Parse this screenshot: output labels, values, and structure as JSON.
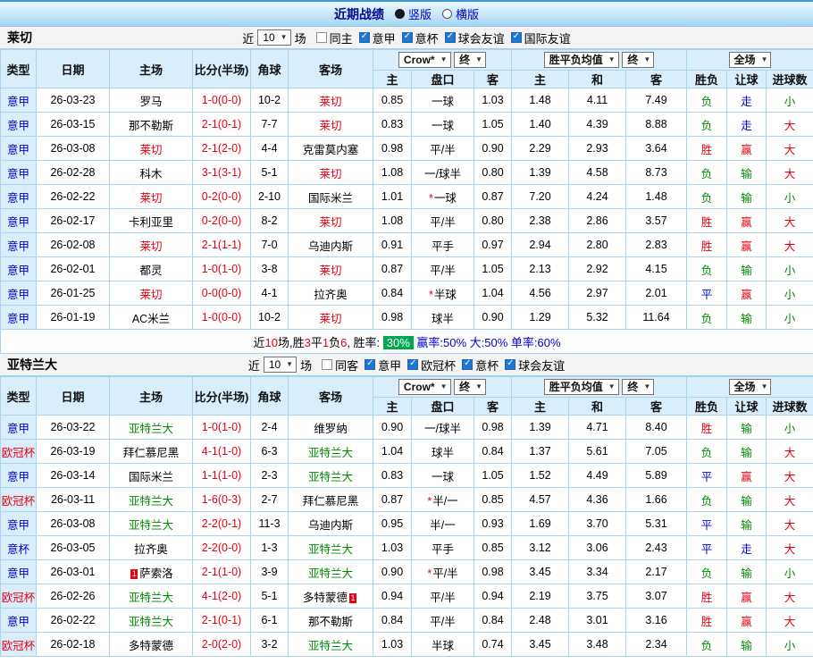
{
  "topbar": {
    "title": "近期战绩",
    "options": [
      {
        "label": "竖版",
        "selected": true
      },
      {
        "label": "横版",
        "selected": false
      }
    ]
  },
  "filter_labels": {
    "near": "近",
    "games": "场"
  },
  "table_header": {
    "type": "类型",
    "date": "日期",
    "home": "主场",
    "score": "比分(半场)",
    "corner": "角球",
    "away": "客场",
    "company": "Crow*",
    "final1": "终",
    "wdl": "胜平负均值",
    "final2": "终",
    "scope": "全场",
    "sub": [
      "主",
      "盘口",
      "客",
      "主",
      "和",
      "客",
      "胜负",
      "让球",
      "进球数"
    ]
  },
  "sections": [
    {
      "team": "莱切",
      "filter": {
        "count": "10",
        "checkboxes": [
          {
            "label": "同主",
            "checked": false
          },
          {
            "label": "意甲",
            "checked": true
          },
          {
            "label": "意杯",
            "checked": true
          },
          {
            "label": "球会友谊",
            "checked": true
          },
          {
            "label": "国际友谊",
            "checked": true
          }
        ]
      },
      "rows": [
        {
          "league": "意甲",
          "league_color": "blue",
          "date": "26-03-23",
          "home": "罗马",
          "home_color": "black",
          "score": "1-0(0-0)",
          "corner": "10-2",
          "away": "莱切",
          "away_color": "red",
          "h_odds": "0.85",
          "handicap": "一球",
          "a_odds": "1.03",
          "win": "1.48",
          "draw": "4.11",
          "lose": "7.49",
          "result": "负",
          "result_color": "green",
          "spread": "走",
          "spread_color": "blue",
          "goals": "小",
          "goals_color": "green"
        },
        {
          "league": "意甲",
          "league_color": "blue",
          "date": "26-03-15",
          "home": "那不勒斯",
          "home_color": "black",
          "score": "2-1(0-1)",
          "corner": "7-7",
          "away": "莱切",
          "away_color": "red",
          "h_odds": "0.83",
          "handicap": "一球",
          "a_odds": "1.05",
          "win": "1.40",
          "draw": "4.39",
          "lose": "8.88",
          "result": "负",
          "result_color": "green",
          "spread": "走",
          "spread_color": "blue",
          "goals": "大",
          "goals_color": "red"
        },
        {
          "league": "意甲",
          "league_color": "blue",
          "date": "26-03-08",
          "home": "莱切",
          "home_color": "red",
          "score": "2-1(2-0)",
          "corner": "4-4",
          "away": "克雷莫内塞",
          "away_color": "black",
          "h_odds": "0.98",
          "handicap": "平/半",
          "a_odds": "0.90",
          "win": "2.29",
          "draw": "2.93",
          "lose": "3.64",
          "result": "胜",
          "result_color": "red",
          "spread": "赢",
          "spread_color": "red",
          "goals": "大",
          "goals_color": "red"
        },
        {
          "league": "意甲",
          "league_color": "blue",
          "date": "26-02-28",
          "home": "科木",
          "home_color": "black",
          "score": "3-1(3-1)",
          "corner": "5-1",
          "away": "莱切",
          "away_color": "red",
          "h_odds": "1.08",
          "handicap": "一/球半",
          "a_odds": "0.80",
          "win": "1.39",
          "draw": "4.58",
          "lose": "8.73",
          "result": "负",
          "result_color": "green",
          "spread": "输",
          "spread_color": "green",
          "goals": "大",
          "goals_color": "red"
        },
        {
          "league": "意甲",
          "league_color": "blue",
          "date": "26-02-22",
          "home": "莱切",
          "home_color": "red",
          "score": "0-2(0-0)",
          "corner": "2-10",
          "away": "国际米兰",
          "away_color": "black",
          "h_odds": "1.01",
          "hstar": "*",
          "handicap": "一球",
          "a_odds": "0.87",
          "win": "7.20",
          "draw": "4.24",
          "lose": "1.48",
          "result": "负",
          "result_color": "green",
          "spread": "输",
          "spread_color": "green",
          "goals": "小",
          "goals_color": "green"
        },
        {
          "league": "意甲",
          "league_color": "blue",
          "date": "26-02-17",
          "home": "卡利亚里",
          "home_color": "black",
          "score": "0-2(0-0)",
          "corner": "8-2",
          "away": "莱切",
          "away_color": "red",
          "h_odds": "1.08",
          "handicap": "平/半",
          "a_odds": "0.80",
          "win": "2.38",
          "draw": "2.86",
          "lose": "3.57",
          "result": "胜",
          "result_color": "red",
          "spread": "赢",
          "spread_color": "red",
          "goals": "大",
          "goals_color": "red"
        },
        {
          "league": "意甲",
          "league_color": "blue",
          "date": "26-02-08",
          "home": "莱切",
          "home_color": "red",
          "score": "2-1(1-1)",
          "corner": "7-0",
          "away": "乌迪内斯",
          "away_color": "black",
          "h_odds": "0.91",
          "handicap": "平手",
          "a_odds": "0.97",
          "win": "2.94",
          "draw": "2.80",
          "lose": "2.83",
          "result": "胜",
          "result_color": "red",
          "spread": "赢",
          "spread_color": "red",
          "goals": "大",
          "goals_color": "red"
        },
        {
          "league": "意甲",
          "league_color": "blue",
          "date": "26-02-01",
          "home": "都灵",
          "home_color": "black",
          "score": "1-0(1-0)",
          "corner": "3-8",
          "away": "莱切",
          "away_color": "red",
          "h_odds": "0.87",
          "handicap": "平/半",
          "a_odds": "1.05",
          "win": "2.13",
          "draw": "2.92",
          "lose": "4.15",
          "result": "负",
          "result_color": "green",
          "spread": "输",
          "spread_color": "green",
          "goals": "小",
          "goals_color": "green"
        },
        {
          "league": "意甲",
          "league_color": "blue",
          "date": "26-01-25",
          "home": "莱切",
          "home_color": "red",
          "score": "0-0(0-0)",
          "corner": "4-1",
          "away": "拉齐奥",
          "away_color": "black",
          "h_odds": "0.84",
          "hstar": "*",
          "handicap": "半球",
          "a_odds": "1.04",
          "win": "4.56",
          "draw": "2.97",
          "lose": "2.01",
          "result": "平",
          "result_color": "blue",
          "spread": "赢",
          "spread_color": "red",
          "goals": "小",
          "goals_color": "green"
        },
        {
          "league": "意甲",
          "league_color": "blue",
          "date": "26-01-19",
          "home": "AC米兰",
          "home_color": "black",
          "score": "1-0(0-0)",
          "corner": "10-2",
          "away": "莱切",
          "away_color": "red",
          "h_odds": "0.98",
          "handicap": "球半",
          "a_odds": "0.90",
          "win": "1.29",
          "draw": "5.32",
          "lose": "11.64",
          "result": "负",
          "result_color": "green",
          "spread": "输",
          "spread_color": "green",
          "goals": "小",
          "goals_color": "green"
        }
      ],
      "footer": [
        {
          "text": "近",
          "style": "black"
        },
        {
          "text": "10",
          "style": "red"
        },
        {
          "text": "场,胜",
          "style": "black"
        },
        {
          "text": "3",
          "style": "red"
        },
        {
          "text": "平",
          "style": "black"
        },
        {
          "text": "1",
          "style": "red"
        },
        {
          "text": "负",
          "style": "black"
        },
        {
          "text": "6",
          "style": "red"
        },
        {
          "text": ", 胜率: ",
          "style": "black"
        },
        {
          "text": "30%",
          "style": "badge"
        },
        {
          "text": " 赢率:50%",
          "style": "blue"
        },
        {
          "text": " 大:50%",
          "style": "blue"
        },
        {
          "text": " 单率:60%",
          "style": "blue"
        }
      ]
    },
    {
      "team": "亚特兰大",
      "filter": {
        "count": "10",
        "checkboxes": [
          {
            "label": "同客",
            "checked": false
          },
          {
            "label": "意甲",
            "checked": true
          },
          {
            "label": "欧冠杯",
            "checked": true
          },
          {
            "label": "意杯",
            "checked": true
          },
          {
            "label": "球会友谊",
            "checked": true
          }
        ]
      },
      "rows": [
        {
          "league": "意甲",
          "league_color": "blue",
          "date": "26-03-22",
          "home": "亚特兰大",
          "home_color": "green",
          "score": "1-0(1-0)",
          "corner": "2-4",
          "away": "维罗纳",
          "away_color": "black",
          "h_odds": "0.90",
          "handicap": "一/球半",
          "a_odds": "0.98",
          "win": "1.39",
          "draw": "4.71",
          "lose": "8.40",
          "result": "胜",
          "result_color": "red",
          "spread": "输",
          "spread_color": "green",
          "goals": "小",
          "goals_color": "green"
        },
        {
          "league": "欧冠杯",
          "league_color": "red",
          "date": "26-03-19",
          "home": "拜仁慕尼黑",
          "home_color": "black",
          "score": "4-1(1-0)",
          "corner": "6-3",
          "away": "亚特兰大",
          "away_color": "green",
          "h_odds": "1.04",
          "handicap": "球半",
          "a_odds": "0.84",
          "win": "1.37",
          "draw": "5.61",
          "lose": "7.05",
          "result": "负",
          "result_color": "green",
          "spread": "输",
          "spread_color": "green",
          "goals": "大",
          "goals_color": "red"
        },
        {
          "league": "意甲",
          "league_color": "blue",
          "date": "26-03-14",
          "home": "国际米兰",
          "home_color": "black",
          "score": "1-1(1-0)",
          "corner": "2-3",
          "away": "亚特兰大",
          "away_color": "green",
          "h_odds": "0.83",
          "handicap": "一球",
          "a_odds": "1.05",
          "win": "1.52",
          "draw": "4.49",
          "lose": "5.89",
          "result": "平",
          "result_color": "blue",
          "spread": "赢",
          "spread_color": "red",
          "goals": "大",
          "goals_color": "red"
        },
        {
          "league": "欧冠杯",
          "league_color": "red",
          "date": "26-03-11",
          "home": "亚特兰大",
          "home_color": "green",
          "score": "1-6(0-3)",
          "corner": "2-7",
          "away": "拜仁慕尼黑",
          "away_color": "black",
          "h_odds": "0.87",
          "hstar": "*",
          "handicap": "半/一",
          "a_odds": "0.85",
          "win": "4.57",
          "draw": "4.36",
          "lose": "1.66",
          "result": "负",
          "result_color": "green",
          "spread": "输",
          "spread_color": "green",
          "goals": "大",
          "goals_color": "red"
        },
        {
          "league": "意甲",
          "league_color": "blue",
          "date": "26-03-08",
          "home": "亚特兰大",
          "home_color": "green",
          "score": "2-2(0-1)",
          "corner": "11-3",
          "away": "乌迪内斯",
          "away_color": "black",
          "h_odds": "0.95",
          "handicap": "半/一",
          "a_odds": "0.93",
          "win": "1.69",
          "draw": "3.70",
          "lose": "5.31",
          "result": "平",
          "result_color": "blue",
          "spread": "输",
          "spread_color": "green",
          "goals": "大",
          "goals_color": "red"
        },
        {
          "league": "意杯",
          "league_color": "blue",
          "date": "26-03-05",
          "home": "拉齐奥",
          "home_color": "black",
          "score": "2-2(0-0)",
          "corner": "1-3",
          "away": "亚特兰大",
          "away_color": "green",
          "h_odds": "1.03",
          "handicap": "平手",
          "a_odds": "0.85",
          "win": "3.12",
          "draw": "3.06",
          "lose": "2.43",
          "result": "平",
          "result_color": "blue",
          "spread": "走",
          "spread_color": "blue",
          "goals": "大",
          "goals_color": "red"
        },
        {
          "league": "意甲",
          "league_color": "blue",
          "date": "26-03-01",
          "home": "萨索洛",
          "home_color": "black",
          "home_card": "1",
          "score": "2-1(1-0)",
          "corner": "3-9",
          "away": "亚特兰大",
          "away_color": "green",
          "h_odds": "0.90",
          "hstar": "*",
          "handicap": "平/半",
          "a_odds": "0.98",
          "win": "3.45",
          "draw": "3.34",
          "lose": "2.17",
          "result": "负",
          "result_color": "green",
          "spread": "输",
          "spread_color": "green",
          "goals": "小",
          "goals_color": "green"
        },
        {
          "league": "欧冠杯",
          "league_color": "red",
          "date": "26-02-26",
          "home": "亚特兰大",
          "home_color": "green",
          "score": "4-1(2-0)",
          "corner": "5-1",
          "away": "多特蒙德",
          "away_color": "black",
          "away_card": "1",
          "h_odds": "0.94",
          "handicap": "平/半",
          "a_odds": "0.94",
          "win": "2.19",
          "draw": "3.75",
          "lose": "3.07",
          "result": "胜",
          "result_color": "red",
          "spread": "赢",
          "spread_color": "red",
          "goals": "大",
          "goals_color": "red"
        },
        {
          "league": "意甲",
          "league_color": "blue",
          "date": "26-02-22",
          "home": "亚特兰大",
          "home_color": "green",
          "score": "2-1(0-1)",
          "corner": "6-1",
          "away": "那不勒斯",
          "away_color": "black",
          "h_odds": "0.84",
          "handicap": "平/半",
          "a_odds": "0.84",
          "win": "2.48",
          "draw": "3.01",
          "lose": "3.16",
          "result": "胜",
          "result_color": "red",
          "spread": "赢",
          "spread_color": "red",
          "goals": "大",
          "goals_color": "red"
        },
        {
          "league": "欧冠杯",
          "league_color": "red",
          "date": "26-02-18",
          "home": "多特蒙德",
          "home_color": "black",
          "score": "2-0(2-0)",
          "corner": "3-2",
          "away": "亚特兰大",
          "away_color": "green",
          "h_odds": "1.03",
          "handicap": "半球",
          "a_odds": "0.74",
          "win": "3.45",
          "draw": "3.48",
          "lose": "2.34",
          "result": "负",
          "result_color": "green",
          "spread": "输",
          "spread_color": "green",
          "goals": "小",
          "goals_color": "green"
        }
      ]
    }
  ]
}
